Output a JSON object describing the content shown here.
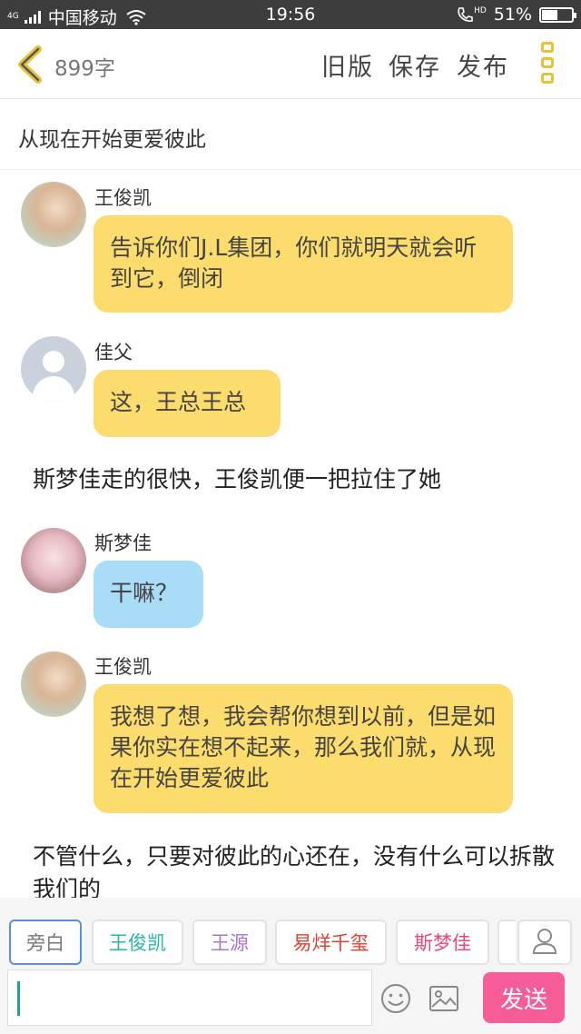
{
  "status_bar": {
    "network_tag": "4G",
    "carrier": "中国移动",
    "time": "19:56",
    "hd": "HD",
    "battery": "51%",
    "battery_level": 0.51
  },
  "top_bar": {
    "word_count": "899字",
    "actions": [
      "旧版",
      "保存",
      "发布"
    ],
    "accent_color": "#e8c236"
  },
  "story_title": "从现在开始更爱彼此",
  "messages": [
    {
      "speaker": "王俊凯",
      "text": "告诉你们J.L集团，你们就明天就会听到它，倒闭"
    },
    {
      "speaker": "佳父",
      "text": "这，王总王总"
    },
    {
      "narration": "斯梦佳走的很快，王俊凯便一把拉住了她"
    },
    {
      "speaker": "斯梦佳",
      "text": "干嘛？"
    },
    {
      "speaker": "王俊凯",
      "text": "我想了想，我会帮你想到以前，但是如果你实在想不起来，那么我们就，从现在开始更爱彼此"
    },
    {
      "narration": "不管什么，只要对彼此的心还在，没有什么可以拆散我们的"
    }
  ],
  "role_chips": [
    {
      "label": "旁白",
      "color": "#777777"
    },
    {
      "label": "王俊凯",
      "color": "#22b8a8"
    },
    {
      "label": "王源",
      "color": "#a775c9"
    },
    {
      "label": "易烊千玺",
      "color": "#e0402e"
    },
    {
      "label": "斯梦佳",
      "color": "#e9477a"
    }
  ],
  "input": {
    "placeholder": ""
  },
  "send_label": "发送",
  "colors": {
    "yellow_bubble": "#fcdc6d",
    "blue_bubble": "#a9dcf7",
    "send_button": "#f65d98"
  }
}
